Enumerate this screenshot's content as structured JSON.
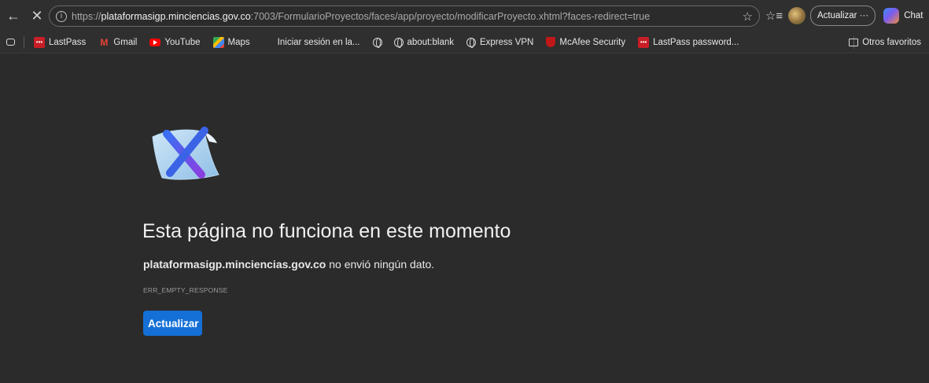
{
  "address_bar": {
    "url_scheme": "https://",
    "url_host": "plataformasigp.minciencias.gov.co",
    "url_rest": ":7003/FormularioProyectos/faces/app/proyecto/modificarProyecto.xhtml?faces-redirect=true",
    "update_label": "Actualizar ···",
    "chat_label": "Chat"
  },
  "bookmarks": {
    "items": [
      {
        "label": "LastPass",
        "icon": "lastpass-icon"
      },
      {
        "label": "Gmail",
        "icon": "gmail-icon"
      },
      {
        "label": "YouTube",
        "icon": "youtube-icon"
      },
      {
        "label": "Maps",
        "icon": "maps-icon"
      },
      {
        "label": "Iniciar sesión en la...",
        "icon": "microsoft-icon"
      },
      {
        "label": "",
        "icon": "globe-icon"
      },
      {
        "label": "about:blank",
        "icon": "globe-icon"
      },
      {
        "label": "Express VPN",
        "icon": "globe-icon"
      },
      {
        "label": "McAfee Security",
        "icon": "mcafee-icon"
      },
      {
        "label": "LastPass password...",
        "icon": "lastpass-icon"
      }
    ],
    "other_favorites": "Otros favoritos"
  },
  "error": {
    "title": "Esta página no funciona en este momento",
    "host": "plataformasigp.minciencias.gov.co",
    "message": " no envió ningún dato.",
    "code": "ERR_EMPTY_RESPONSE",
    "reload_label": "Actualizar"
  },
  "colors": {
    "background": "#2b2b2b",
    "button": "#1470d6"
  }
}
